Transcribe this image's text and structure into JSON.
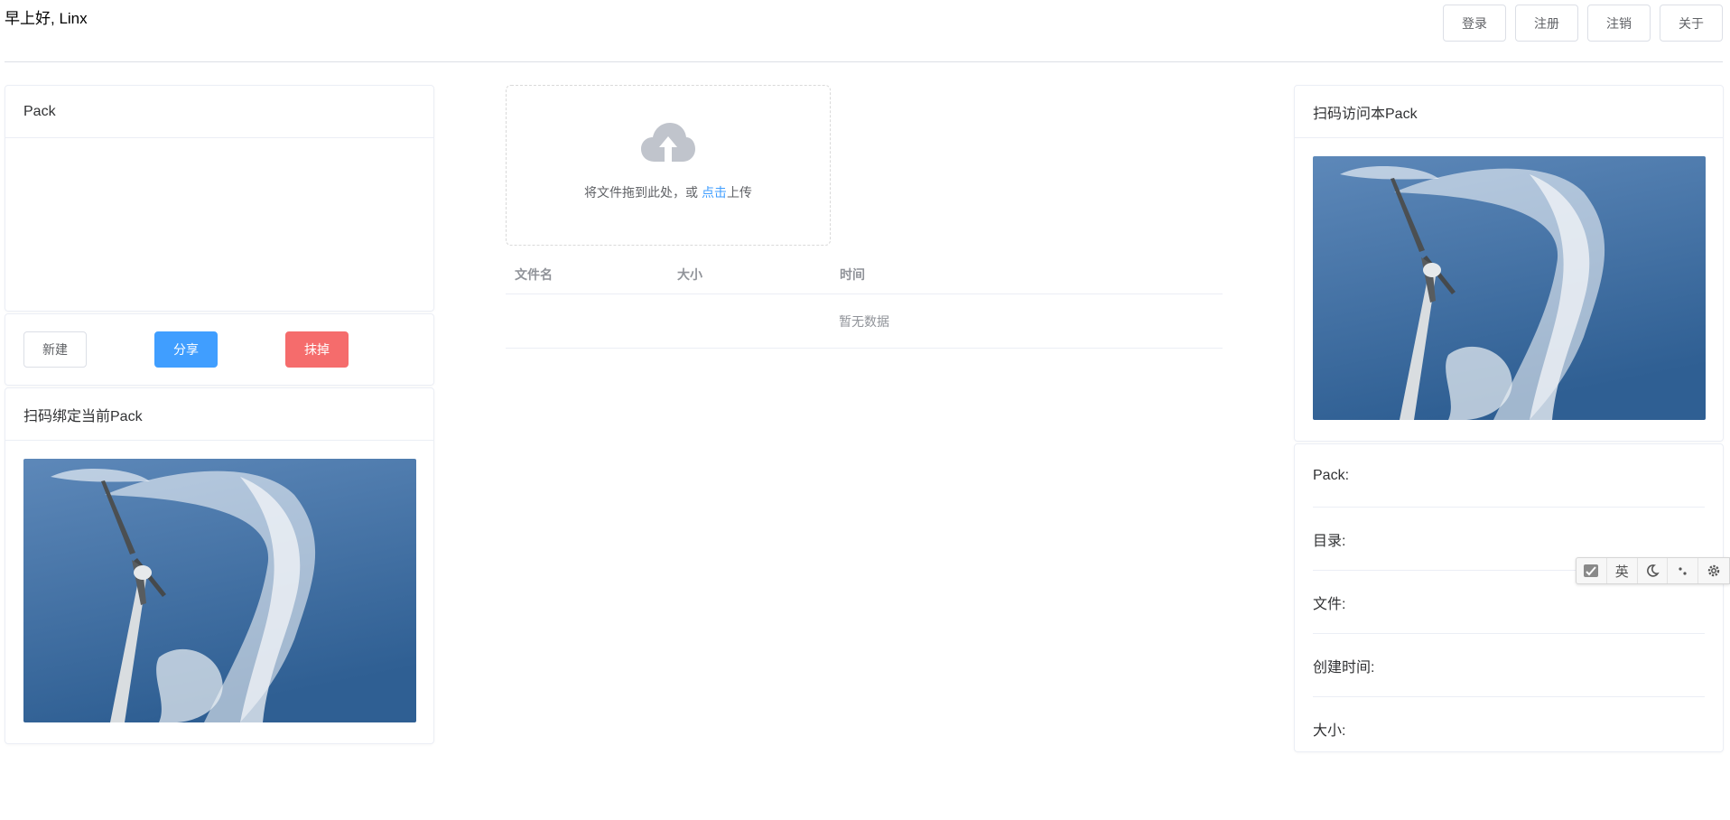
{
  "header": {
    "greeting": "早上好, Linx",
    "nav": [
      "登录",
      "注册",
      "注销",
      "关于"
    ]
  },
  "pack_card": {
    "title": "Pack"
  },
  "actions": {
    "new": "新建",
    "share": "分享",
    "wipe": "抹掉"
  },
  "bind_card": {
    "title": "扫码绑定当前Pack"
  },
  "upload": {
    "text_before": "将文件拖到此处，或 ",
    "link": "点击",
    "text_after": "上传"
  },
  "file_table": {
    "columns": [
      "文件名",
      "大小",
      "时间"
    ],
    "empty_text": "暂无数据"
  },
  "visit_card": {
    "title": "扫码访问本Pack"
  },
  "info": {
    "rows": [
      "Pack:",
      "目录:",
      "文件:",
      "创建时间:",
      "大小:"
    ]
  },
  "ime_toolbar": {
    "lang": "英"
  },
  "colors": {
    "primary": "#409eff",
    "danger": "#f56c6c",
    "border": "#dcdfe6",
    "sky": "#3f6fa3"
  }
}
